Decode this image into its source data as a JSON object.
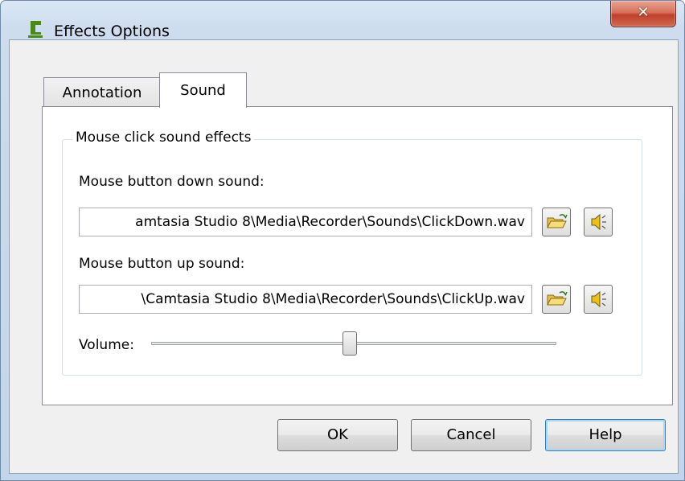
{
  "window": {
    "title": "Effects Options",
    "close_label": "x"
  },
  "tabs": [
    {
      "label": "Annotation",
      "selected": false
    },
    {
      "label": "Sound",
      "selected": true
    }
  ],
  "group": {
    "title": "Mouse click sound effects",
    "down": {
      "label": "Mouse button down sound:",
      "value": "amtasia Studio 8\\Media\\Recorder\\Sounds\\ClickDown.wav"
    },
    "up": {
      "label": "Mouse button up sound:",
      "value": "\\Camtasia Studio 8\\Media\\Recorder\\Sounds\\ClickUp.wav"
    },
    "volume": {
      "label": "Volume:",
      "level": 0.49
    }
  },
  "buttons": {
    "ok": "OK",
    "cancel": "Cancel",
    "help": "Help"
  },
  "icons": {
    "app": "camtasia-logo-icon",
    "browse": "open-folder-icon",
    "play": "speaker-icon"
  }
}
